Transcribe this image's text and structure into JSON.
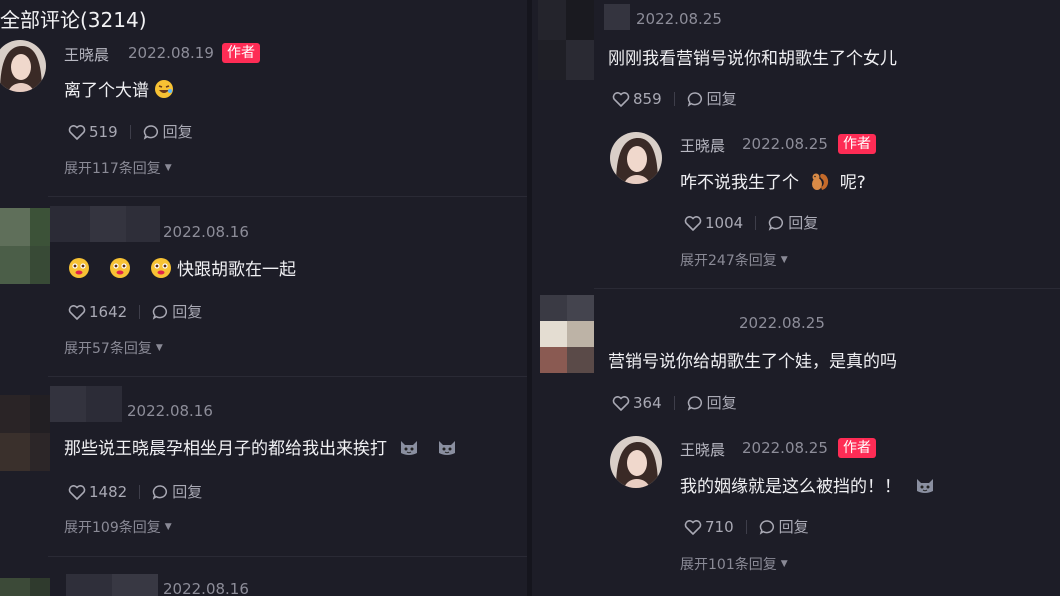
{
  "left": {
    "header": "全部评论(3214)",
    "comments": [
      {
        "name": "王晓晨",
        "date": "2022.08.19",
        "badge": "作者",
        "text": "离了个大谱",
        "likes": "519",
        "reply": "回复",
        "expand": "展开117条回复"
      },
      {
        "date": "2022.08.16",
        "text": "快跟胡歌在一起",
        "likes": "1642",
        "reply": "回复",
        "expand": "展开57条回复"
      },
      {
        "date": "2022.08.16",
        "text": "那些说王晓晨孕相坐月子的都给我出来挨打",
        "likes": "1482",
        "reply": "回复",
        "expand": "展开109条回复"
      },
      {
        "date": "2022.08.16"
      }
    ]
  },
  "right": {
    "comments": [
      {
        "date": "2022.08.25",
        "text": "刚刚我看营销号说你和胡歌生了个女儿",
        "likes": "859",
        "reply": "回复"
      },
      {
        "name": "王晓晨",
        "date": "2022.08.25",
        "badge": "作者",
        "text_before": "咋不说我生了个",
        "text_after": "呢?",
        "likes": "1004",
        "reply": "回复",
        "expand": "展开247条回复"
      },
      {
        "date": "2022.08.25",
        "text": "营销号说你给胡歌生了个娃，是真的吗",
        "likes": "364",
        "reply": "回复"
      },
      {
        "name": "王晓晨",
        "date": "2022.08.25",
        "badge": "作者",
        "text": "我的姻缘就是这么被挡的！！",
        "likes": "710",
        "reply": "回复",
        "expand": "展开101条回复"
      }
    ]
  },
  "colors": {
    "background": "#1d1d27",
    "badge": "#fe2c55",
    "text": "#f0f0f3",
    "muted": "#8d8d99"
  }
}
